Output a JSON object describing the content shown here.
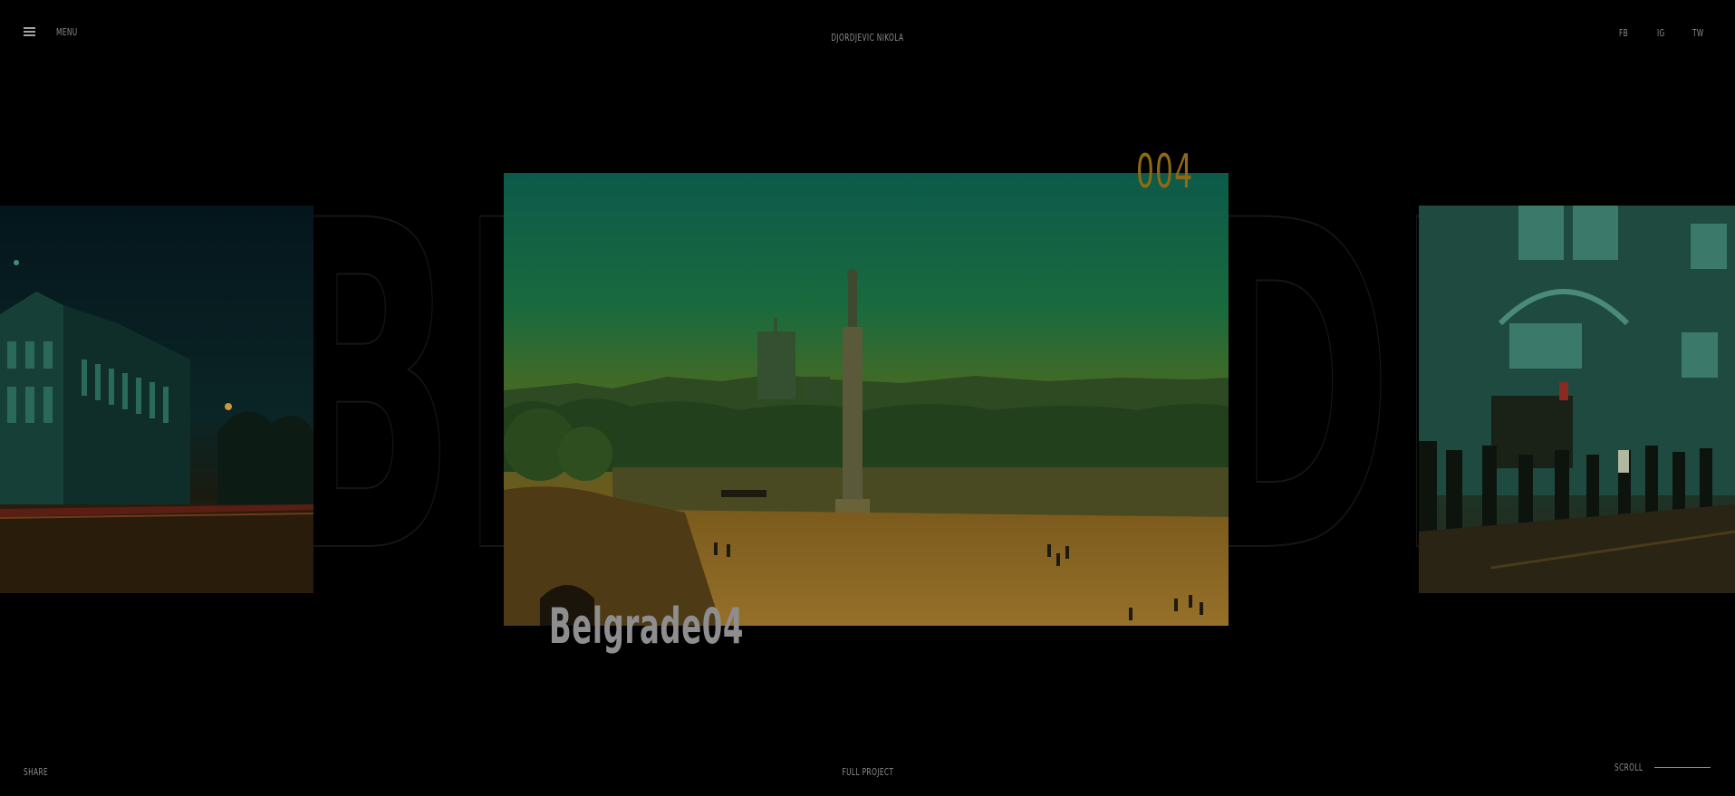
{
  "header": {
    "menu_label": "Menu",
    "site_title": "Djordjevic Nikola",
    "social": [
      "FB",
      "IG",
      "TW"
    ]
  },
  "slider": {
    "current_number": "004",
    "current_title": "Belgrade04",
    "ghost_text_left": "BE",
    "ghost_text_right": "DE"
  },
  "footer": {
    "share_label": "Share",
    "full_project_label": "Full project",
    "scroll_label": "Scroll"
  },
  "colors": {
    "background": "#000000",
    "accent": "#8f6a12",
    "text": "#8c8c8c"
  }
}
